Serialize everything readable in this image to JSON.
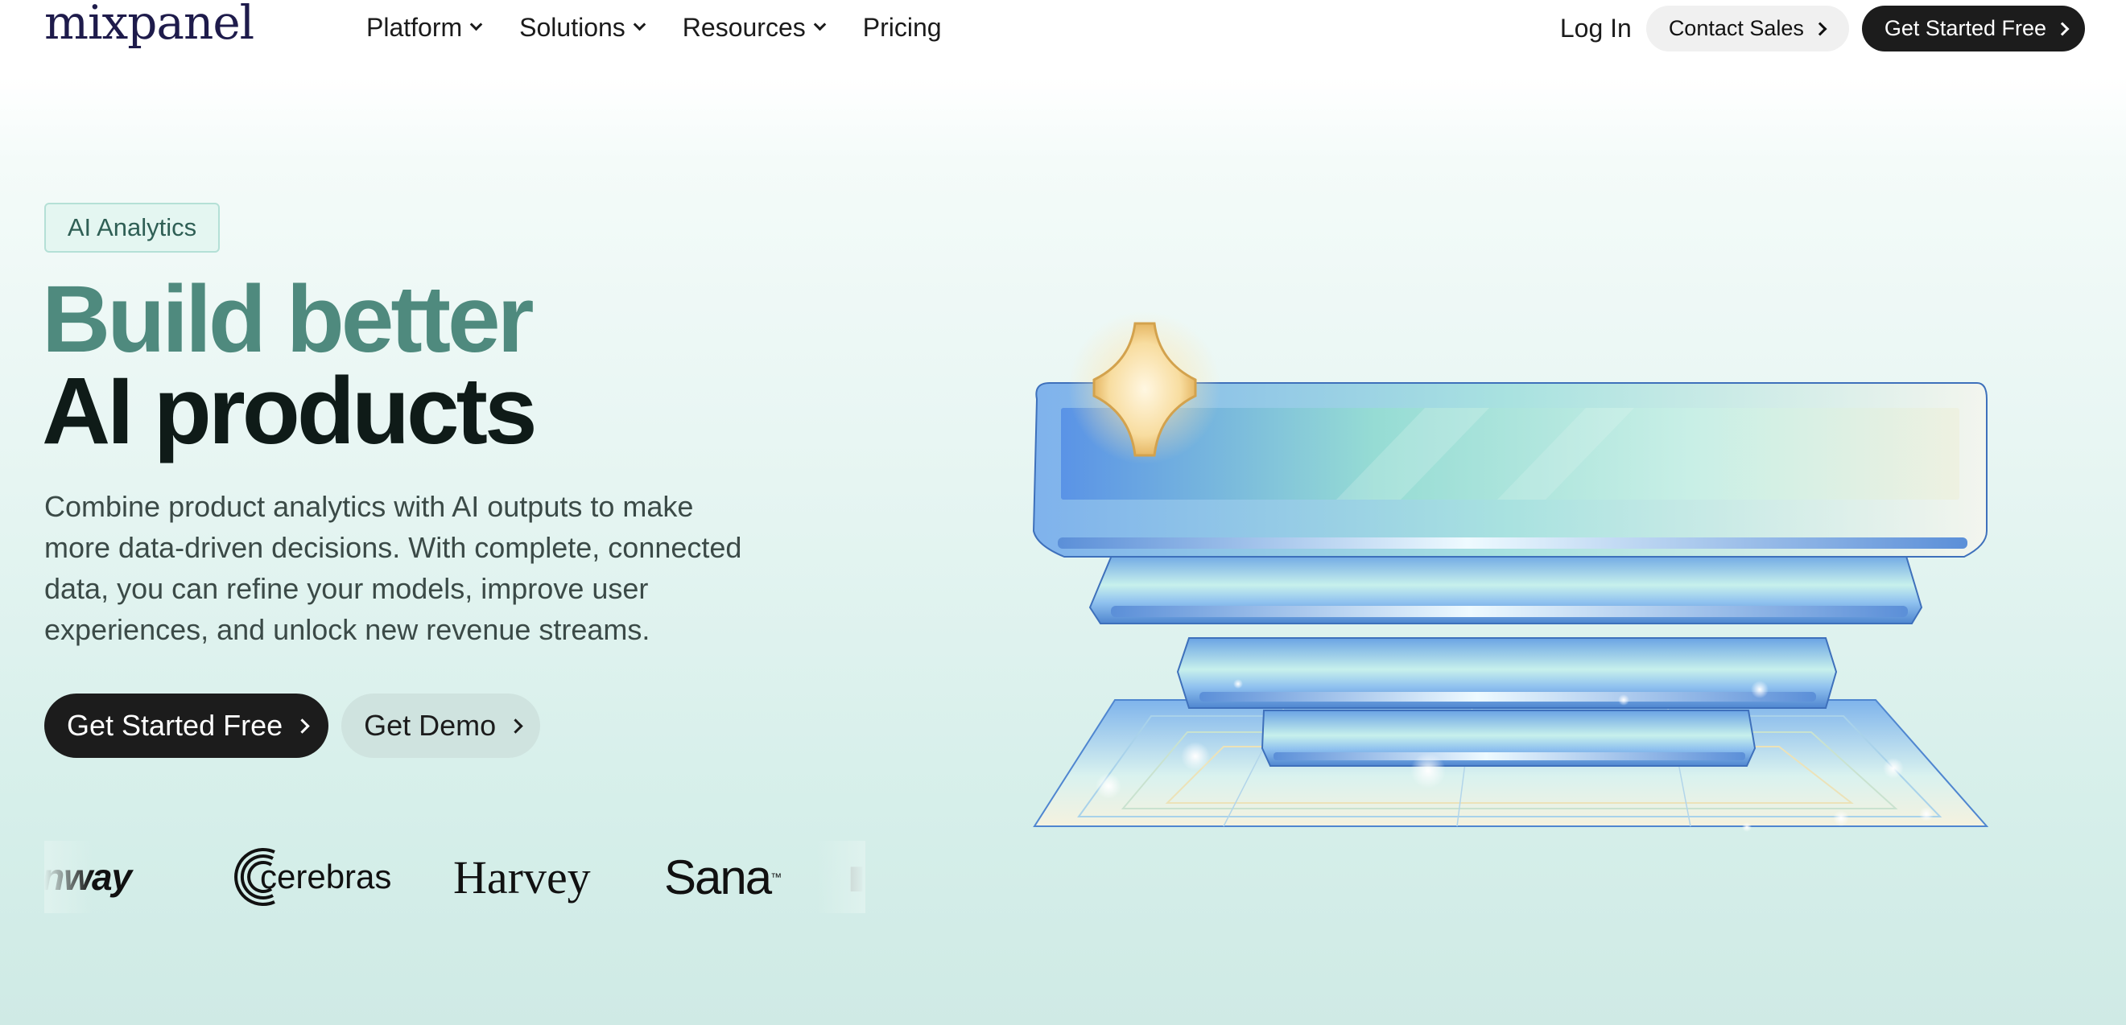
{
  "nav": {
    "logo": "mixpanel",
    "links": [
      {
        "label": "Platform",
        "has_dropdown": true
      },
      {
        "label": "Solutions",
        "has_dropdown": true
      },
      {
        "label": "Resources",
        "has_dropdown": true
      },
      {
        "label": "Pricing",
        "has_dropdown": false
      }
    ],
    "login_label": "Log In",
    "contact_label": "Contact Sales",
    "get_started_label": "Get Started Free"
  },
  "hero": {
    "badge": "AI Analytics",
    "headline_line1": "Build better",
    "headline_line2": "AI products",
    "description": "Combine product analytics with AI outputs to make more data-driven decisions. With complete, connected data, you can refine your models, improve user experiences, and unlock new revenue streams.",
    "cta_primary": "Get Started Free",
    "cta_secondary": "Get Demo"
  },
  "customer_logos": [
    "unway",
    "cerebras",
    "Harvey",
    "Sana"
  ],
  "colors": {
    "headline_accent": "#4f8a7e",
    "headline_dark": "#0f1b18",
    "button_dark": "#1c1c1c",
    "brand_logo": "#1e1b4b"
  },
  "icons": {
    "dropdown": "chevron-down-icon",
    "button_arrow": "chevron-right-icon",
    "illustration": "ai-sparkle-stack-illustration"
  }
}
